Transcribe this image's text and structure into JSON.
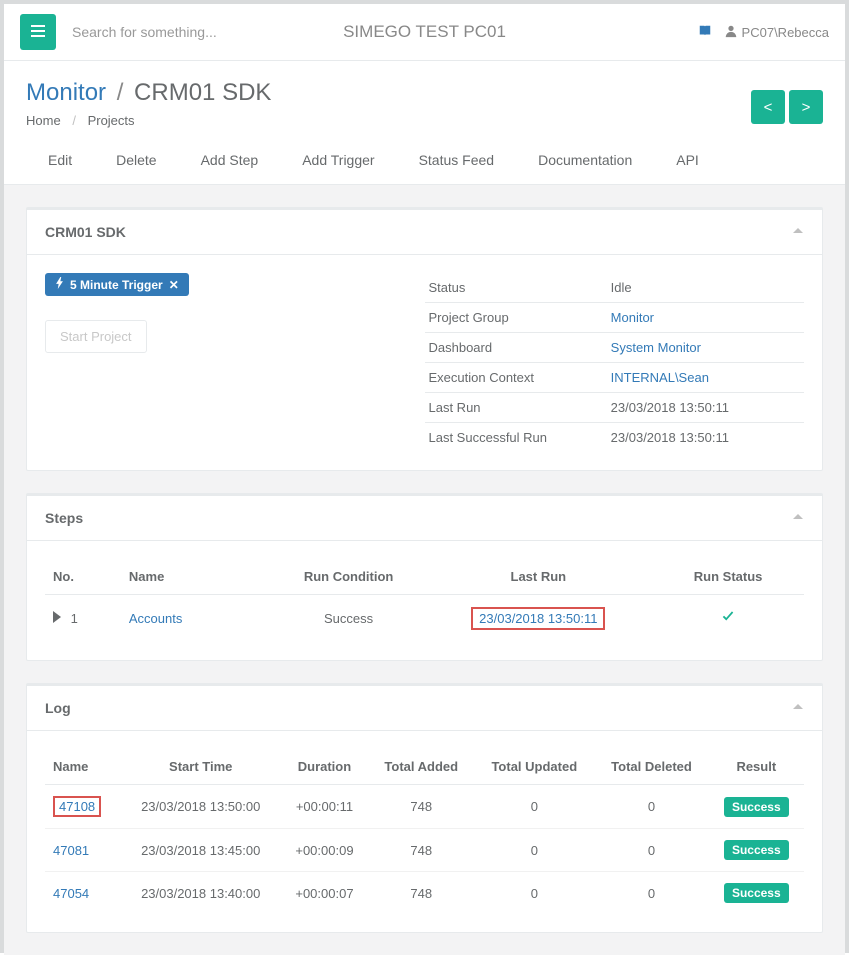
{
  "header": {
    "search_placeholder": "Search for something...",
    "title": "SIMEGO TEST PC01",
    "user": "PC07\\Rebecca"
  },
  "breadcrumb": {
    "monitor": "Monitor",
    "current": "CRM01 SDK",
    "home": "Home",
    "projects": "Projects",
    "prev": "<",
    "next": ">"
  },
  "actions": [
    "Edit",
    "Delete",
    "Add Step",
    "Add Trigger",
    "Status Feed",
    "Documentation",
    "API"
  ],
  "project": {
    "title": "CRM01 SDK",
    "trigger": "5 Minute Trigger",
    "start_btn": "Start Project",
    "info": [
      {
        "label": "Status",
        "value": "Idle",
        "link": false
      },
      {
        "label": "Project Group",
        "value": "Monitor",
        "link": true
      },
      {
        "label": "Dashboard",
        "value": "System Monitor",
        "link": true
      },
      {
        "label": "Execution Context",
        "value": "INTERNAL\\Sean",
        "link": true
      },
      {
        "label": "Last Run",
        "value": "23/03/2018 13:50:11",
        "link": false
      },
      {
        "label": "Last Successful Run",
        "value": "23/03/2018 13:50:11",
        "link": false
      }
    ]
  },
  "steps": {
    "title": "Steps",
    "headers": {
      "no": "No.",
      "name": "Name",
      "run_condition": "Run Condition",
      "last_run": "Last Run",
      "run_status": "Run Status"
    },
    "rows": [
      {
        "no": "1",
        "name": "Accounts",
        "condition": "Success",
        "last_run": "23/03/2018 13:50:11",
        "status": "check"
      }
    ]
  },
  "log": {
    "title": "Log",
    "headers": {
      "name": "Name",
      "start": "Start Time",
      "duration": "Duration",
      "added": "Total Added",
      "updated": "Total Updated",
      "deleted": "Total Deleted",
      "result": "Result"
    },
    "rows": [
      {
        "name": "47108",
        "start": "23/03/2018 13:50:00",
        "duration": "+00:00:11",
        "added": "748",
        "updated": "0",
        "deleted": "0",
        "result": "Success",
        "highlight": true
      },
      {
        "name": "47081",
        "start": "23/03/2018 13:45:00",
        "duration": "+00:00:09",
        "added": "748",
        "updated": "0",
        "deleted": "0",
        "result": "Success",
        "highlight": false
      },
      {
        "name": "47054",
        "start": "23/03/2018 13:40:00",
        "duration": "+00:00:07",
        "added": "748",
        "updated": "0",
        "deleted": "0",
        "result": "Success",
        "highlight": false
      }
    ]
  }
}
